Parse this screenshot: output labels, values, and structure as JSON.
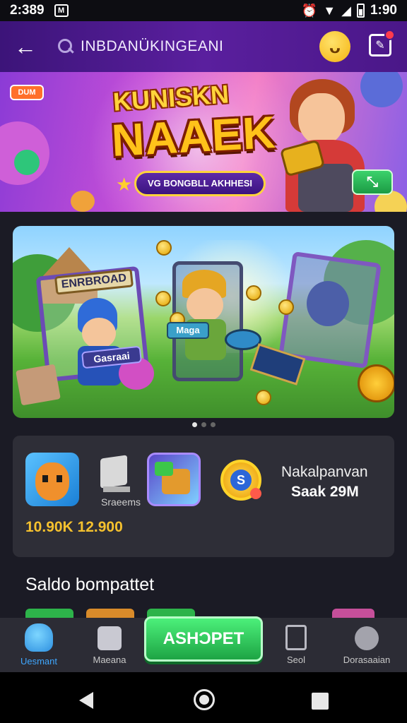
{
  "status_bar": {
    "time": "2:389",
    "clock_right": "1:90"
  },
  "header": {
    "search_text": "INBDANÜKINGEANI"
  },
  "hero": {
    "tag": "DUM",
    "logo_line1": "KUNISKN",
    "logo_line2": "NAAEK",
    "subtitle": "VG BONGBLL AKHHESI"
  },
  "carousel": {
    "frame_label_1": "ENRBROAD",
    "frame_label_2": "Gasraai",
    "sign_label": "Maga",
    "slide_count": 3,
    "active_slide": 1
  },
  "games_panel": {
    "icon_2_label": "Sraeems",
    "title": "Nakalpanvan",
    "subtitle": "Saak 29M",
    "price": "10.90K 12.900"
  },
  "section": {
    "title": "Saldo bompattet"
  },
  "bottom_nav": {
    "items": [
      {
        "label": "Uesmant"
      },
      {
        "label": "Maeana"
      },
      {
        "label": "Seol"
      },
      {
        "label": "Dorasaaian"
      }
    ],
    "cta_label": "ASHƆPET"
  },
  "colors": {
    "app_bar": "#4a1788",
    "accent_green": "#1da444",
    "price_gold": "#f5c12e",
    "active_nav": "#3fa7ff"
  }
}
